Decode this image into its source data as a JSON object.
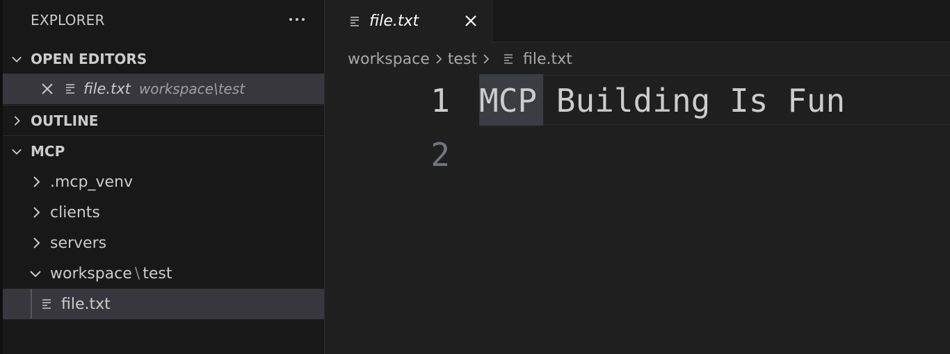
{
  "explorer": {
    "title": "EXPLORER"
  },
  "open_editors": {
    "title": "OPEN EDITORS",
    "items": [
      {
        "label": "file.txt",
        "description": "workspace\\test"
      }
    ]
  },
  "outline": {
    "title": "OUTLINE"
  },
  "folder": {
    "title": "MCP",
    "items": [
      {
        "label": ".mcp_venv"
      },
      {
        "label": "clients"
      },
      {
        "label": "servers"
      },
      {
        "label_part1": "workspace",
        "label_sep": "\\",
        "label_part2": "test"
      },
      {
        "label": "file.txt"
      }
    ]
  },
  "tabs": [
    {
      "label": "file.txt"
    }
  ],
  "breadcrumbs": {
    "items": [
      "workspace",
      "test",
      "file.txt"
    ]
  },
  "editor": {
    "lines": [
      {
        "number": "1",
        "text": "MCP Building Is Fun"
      },
      {
        "number": "2",
        "text": ""
      }
    ]
  },
  "icons": {
    "file": "lines-file-icon",
    "close": "close-icon",
    "chevron_right": "chevron-right-icon",
    "chevron_down": "chevron-down-icon",
    "more": "ellipsis-icon"
  },
  "colors": {
    "sidebar_bg": "#181818",
    "editor_bg": "#1f1f1f",
    "selection_bg": "#37373d",
    "text": "#cccccc",
    "line_number_inactive": "#6e7681"
  }
}
